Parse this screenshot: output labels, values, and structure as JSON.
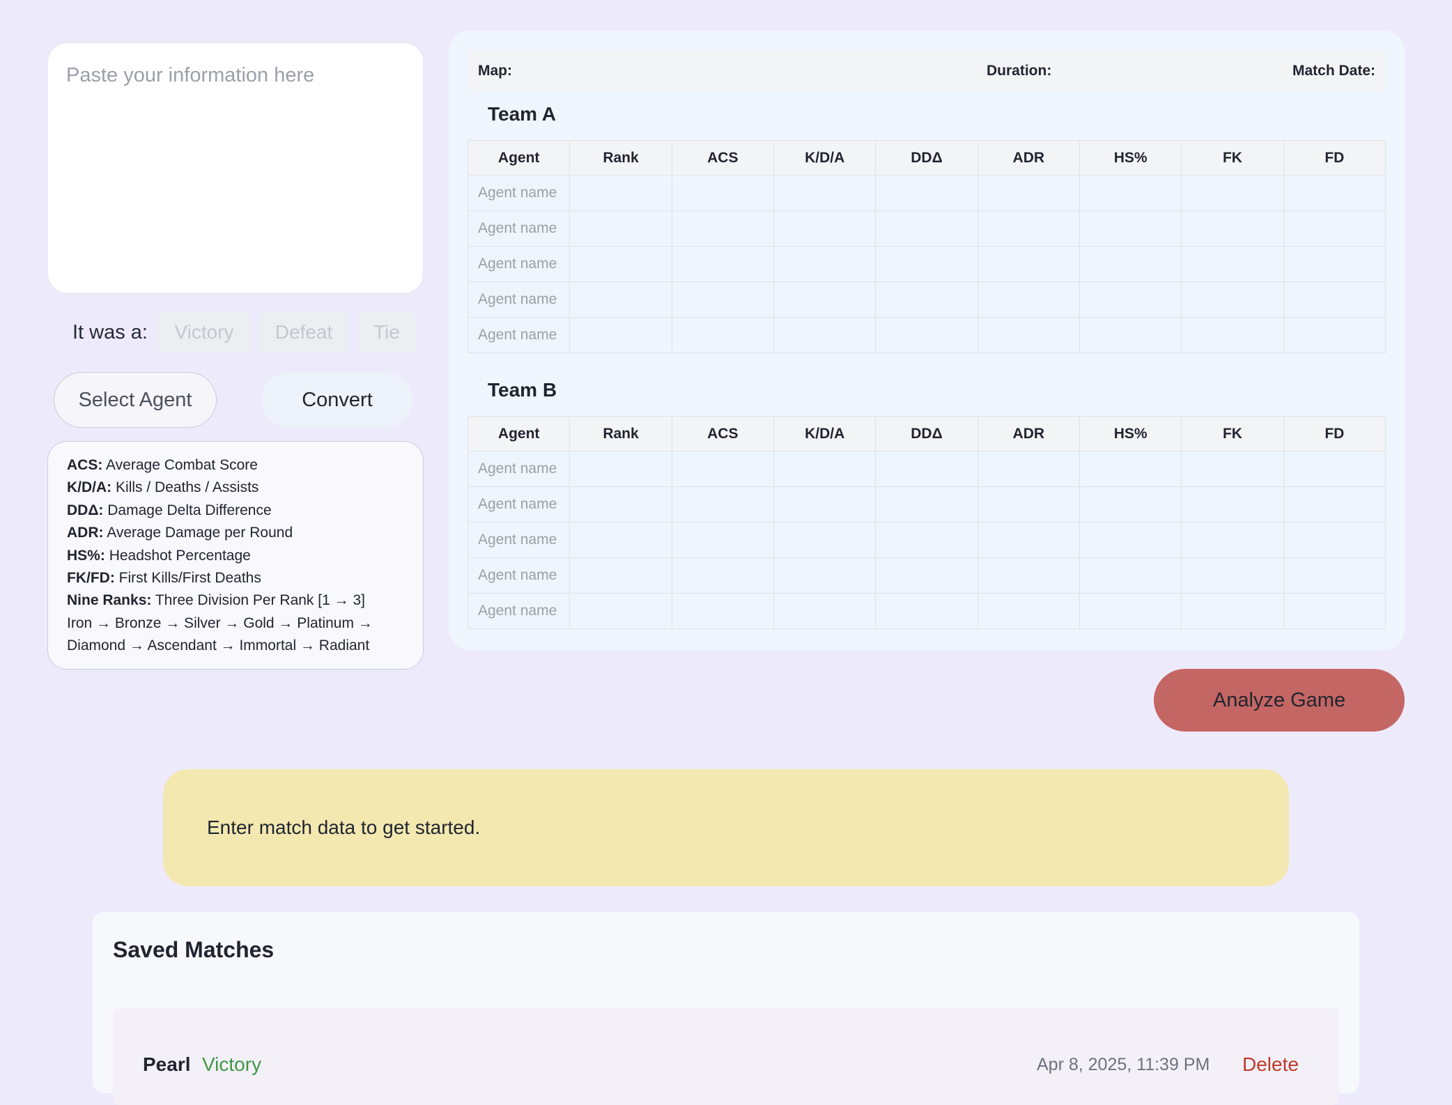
{
  "input": {
    "placeholder": "Paste your information here"
  },
  "result": {
    "label": "It was a:",
    "options": [
      "Victory",
      "Defeat",
      "Tie"
    ]
  },
  "actions": {
    "select_agent": "Select Agent",
    "convert": "Convert",
    "analyze": "Analyze Game"
  },
  "legend": {
    "items": [
      {
        "key": "ACS:",
        "desc": "Average Combat Score"
      },
      {
        "key": "K/D/A:",
        "desc": "Kills / Deaths / Assists"
      },
      {
        "key": "DDΔ:",
        "desc": "Damage Delta Difference"
      },
      {
        "key": "ADR:",
        "desc": "Average Damage per Round"
      },
      {
        "key": "HS%:",
        "desc": "Headshot Percentage"
      },
      {
        "key": "FK/FD:",
        "desc": "First Kills/First Deaths"
      },
      {
        "key": "Nine Ranks:",
        "desc": "Three Division Per Rank [1 → 3]"
      }
    ],
    "ranks_line1": "Iron → Bronze → Silver → Gold → Platinum →",
    "ranks_line2": "Diamond → Ascendant → Immortal → Radiant"
  },
  "match_meta": {
    "map_label": "Map:",
    "duration_label": "Duration:",
    "date_label": "Match Date:"
  },
  "teams": [
    {
      "title": "Team A",
      "rows": [
        "Agent name",
        "Agent name",
        "Agent name",
        "Agent name",
        "Agent name"
      ]
    },
    {
      "title": "Team B",
      "rows": [
        "Agent name",
        "Agent name",
        "Agent name",
        "Agent name",
        "Agent name"
      ]
    }
  ],
  "columns": [
    "Agent",
    "Rank",
    "ACS",
    "K/D/A",
    "DDΔ",
    "ADR",
    "HS%",
    "FK",
    "FD"
  ],
  "notice": "Enter match data to get started.",
  "saved": {
    "title": "Saved Matches",
    "items": [
      {
        "map": "Pearl",
        "result": "Victory",
        "date": "Apr 8, 2025, 11:39 PM",
        "delete_label": "Delete"
      }
    ]
  },
  "colors": {
    "background": "#edebfb",
    "analyze": "#c46663",
    "notice": "#f3e8b0",
    "victory": "#3e9a45",
    "delete": "#c0392b"
  }
}
